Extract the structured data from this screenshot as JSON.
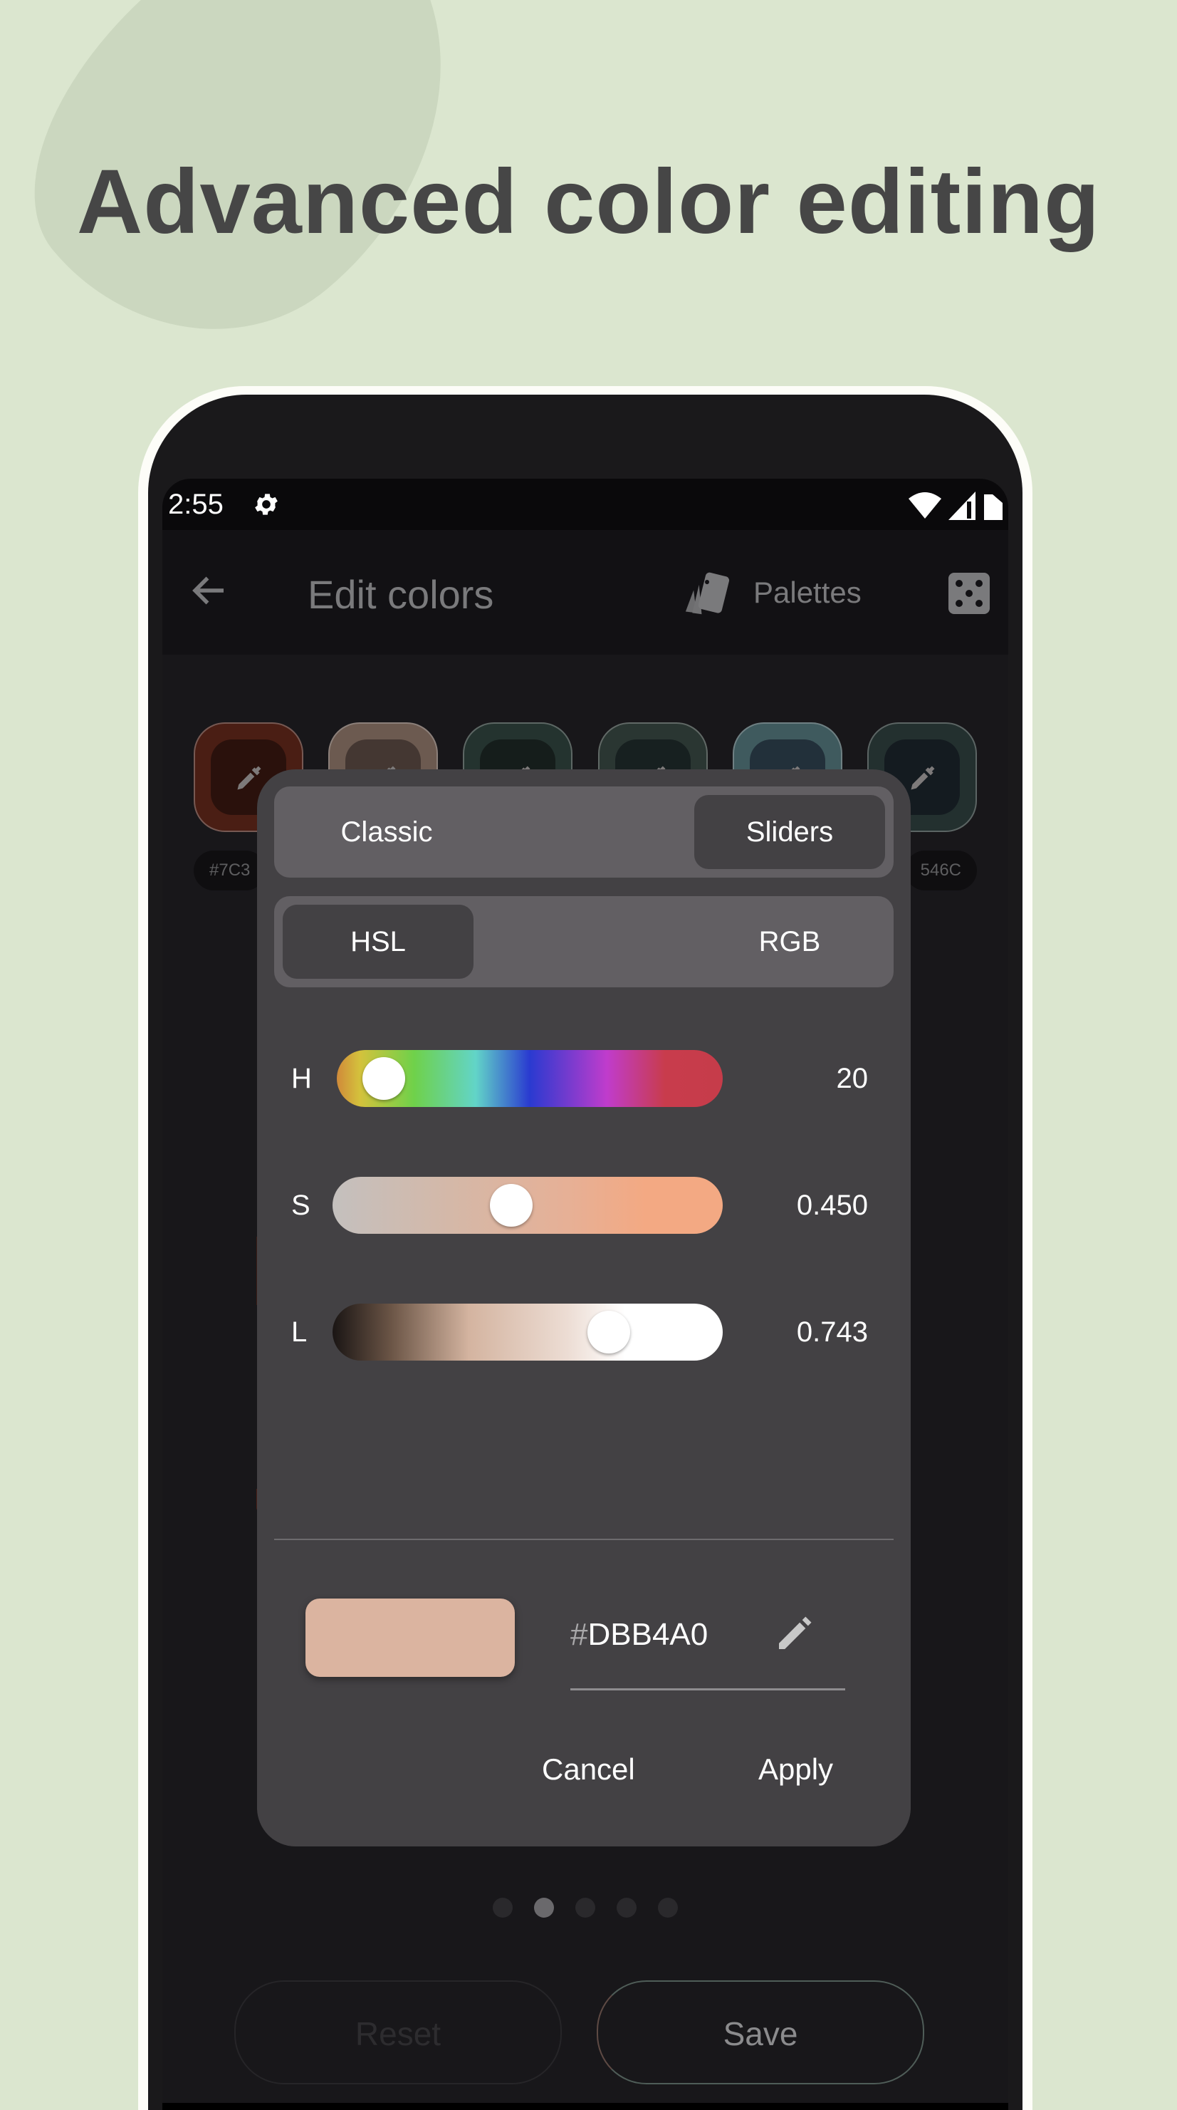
{
  "headline": "Advanced color editing",
  "statusbar": {
    "time": "2:55",
    "icons": [
      "gear-icon",
      "wifi-icon",
      "signal-icon",
      "battery-icon"
    ]
  },
  "appbar": {
    "back_icon": "arrow-left-icon",
    "title": "Edit colors",
    "palettes_icon": "swatchbook-icon",
    "palettes_label": "Palettes",
    "random_icon": "dice-icon"
  },
  "swatches": [
    {
      "outer": "#4a1e14",
      "inner": "#2a110c",
      "hex": "#7C3"
    },
    {
      "outer": "#6c5a50",
      "inner": "#443732"
    },
    {
      "outer": "#24332f",
      "inner": "#151d1b"
    },
    {
      "outer": "#2a3632",
      "inner": "#172020"
    },
    {
      "outer": "#3f5a5e",
      "inner": "#22303a"
    },
    {
      "outer": "#23302f",
      "inner": "#141b20",
      "hex": "546C"
    }
  ],
  "dialog": {
    "mode_tabs": [
      {
        "label": "Classic",
        "selected": false
      },
      {
        "label": "Sliders",
        "selected": true
      }
    ],
    "model_tabs": [
      {
        "label": "HSL",
        "selected": true
      },
      {
        "label": "RGB",
        "selected": false
      }
    ],
    "sliders": [
      {
        "label": "H",
        "value": "20",
        "position": 0.056
      },
      {
        "label": "S",
        "value": "0.450",
        "position": 0.45
      },
      {
        "label": "L",
        "value": "0.743",
        "position": 0.743
      }
    ],
    "preview_color": "#DBB4A0",
    "hex_hash": "#",
    "hex_value": "DBB4A0",
    "edit_icon": "pencil-icon",
    "cancel_label": "Cancel",
    "apply_label": "Apply"
  },
  "page_indicator": {
    "count": 5,
    "active": 1
  },
  "bottom_buttons": {
    "reset_label": "Reset",
    "save_label": "Save"
  }
}
